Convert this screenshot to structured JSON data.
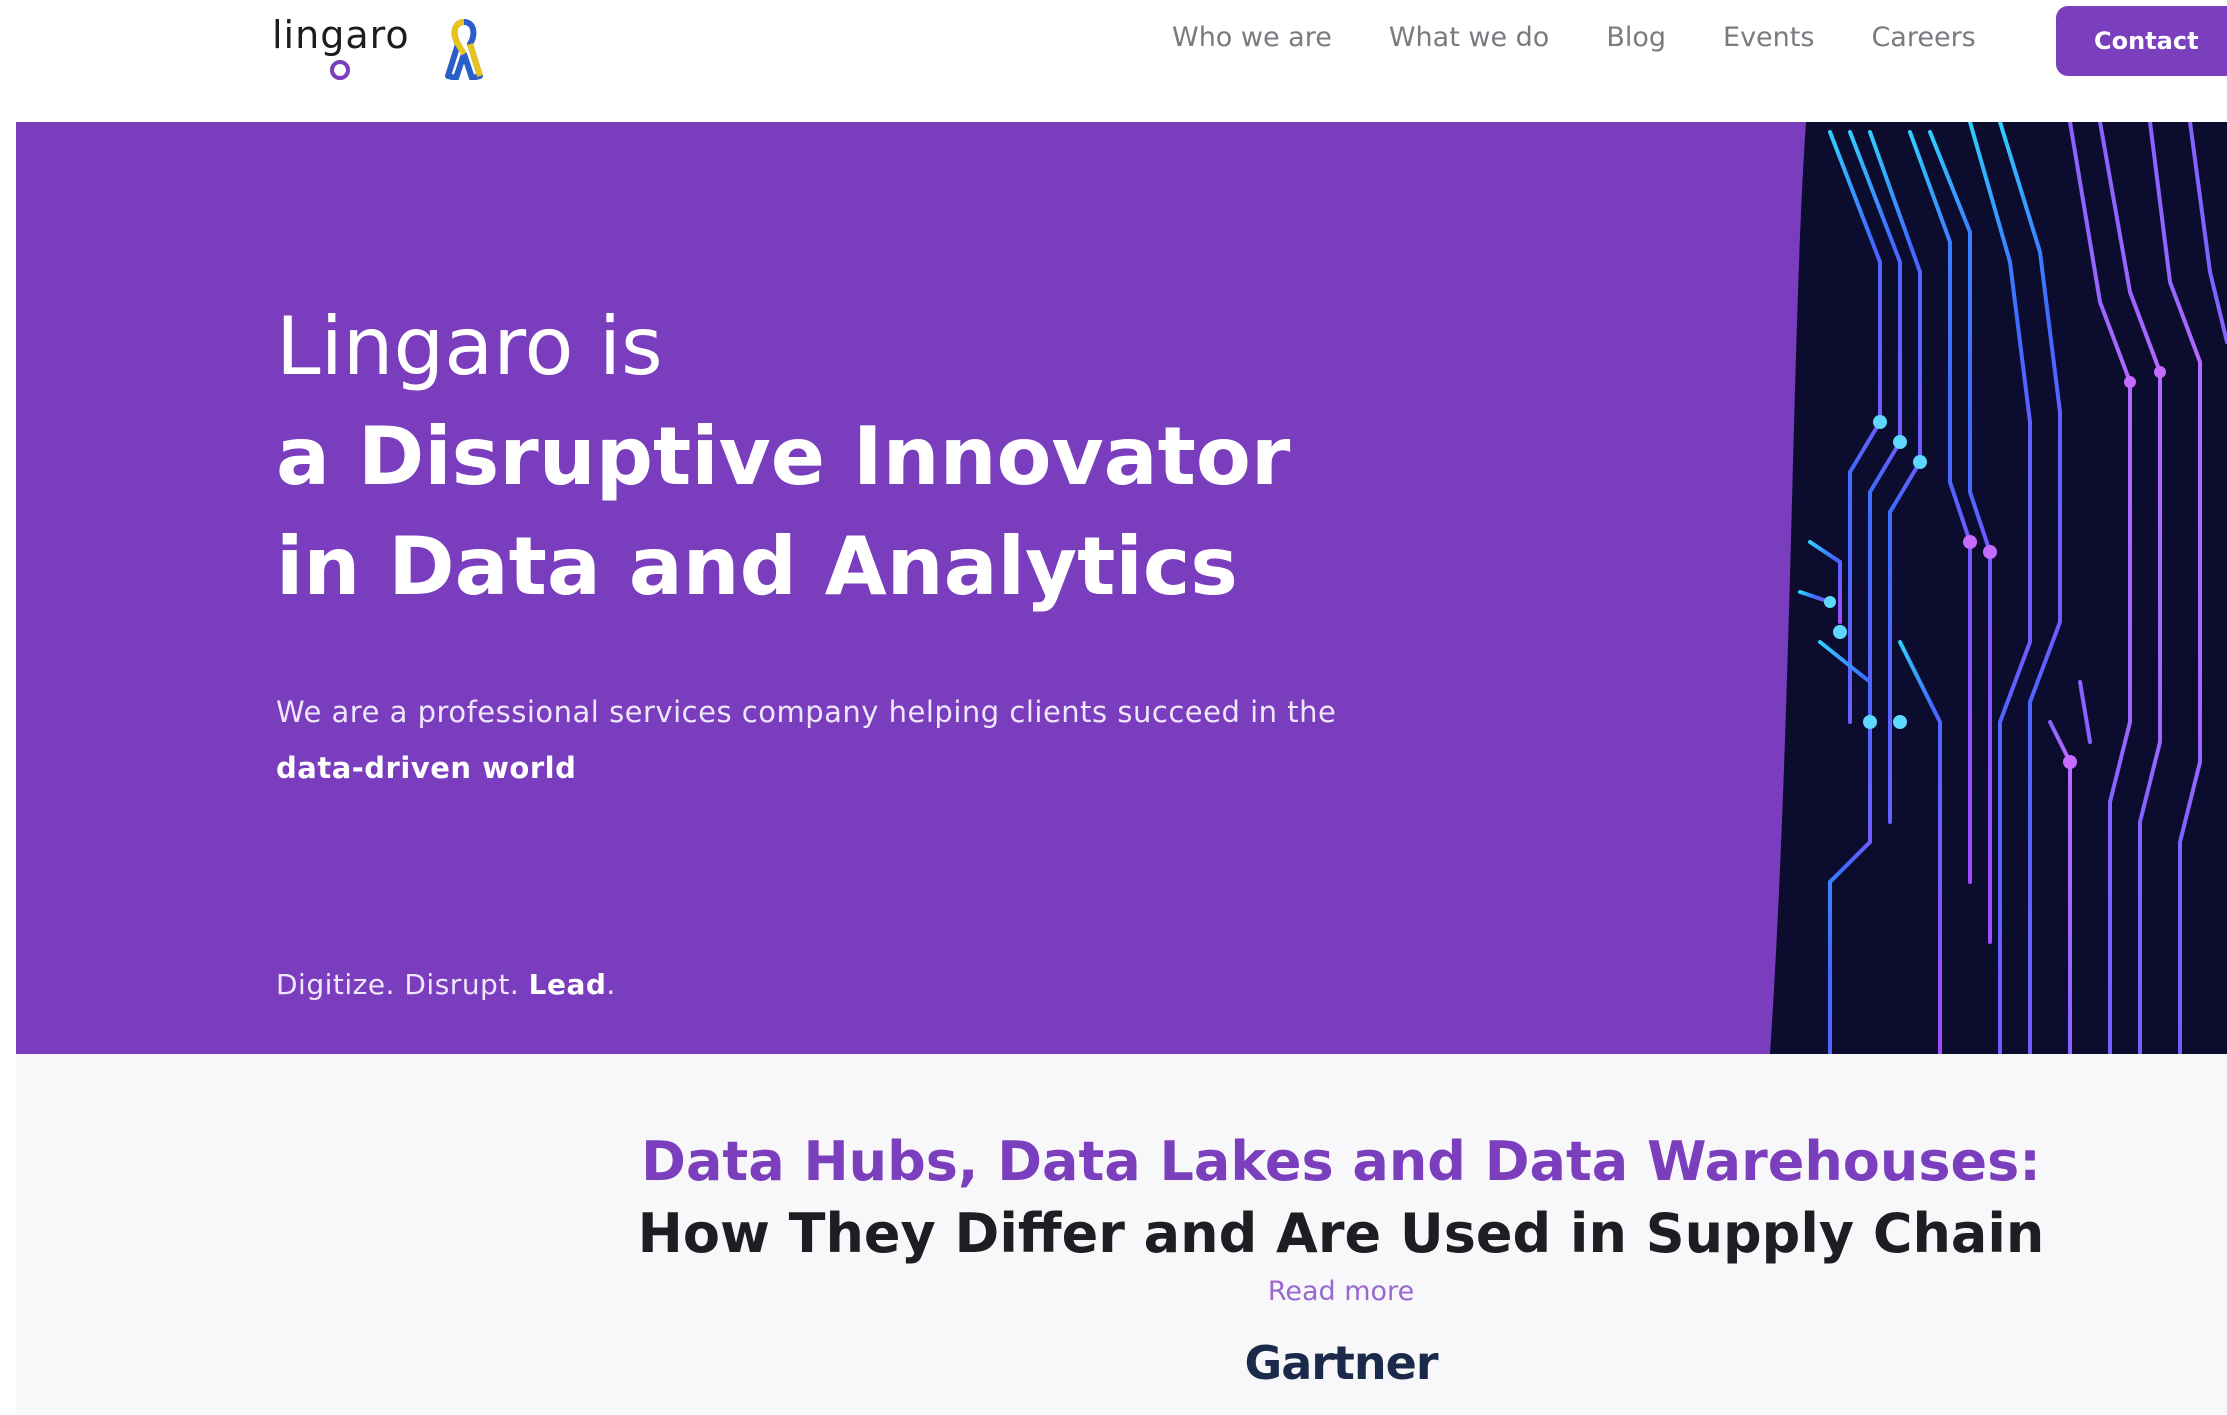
{
  "header": {
    "logo_text": "lingaro",
    "nav": [
      {
        "label": "Who we are"
      },
      {
        "label": "What we do"
      },
      {
        "label": "Blog"
      },
      {
        "label": "Events"
      },
      {
        "label": "Careers"
      }
    ],
    "contact_label": "Contact"
  },
  "hero": {
    "title_line1": "Lingaro is",
    "title_line2": "a Disruptive Innovator",
    "title_line3": "in Data and Analytics",
    "subtitle": "We are a professional services company helping clients succeed in the",
    "subtitle_strong": "data-driven world",
    "tagline_part1": "Digitize. Disrupt. ",
    "tagline_strong": "Lead",
    "tagline_end": "."
  },
  "feature": {
    "title_purple": "Data Hubs, Data Lakes and Data Warehouses:",
    "title_dark": "How They Differ and Are Used in Supply Chain",
    "read_more": "Read more",
    "partner_logo_text": "Gartner"
  },
  "colors": {
    "brand_purple": "#7a3dbe",
    "button_purple": "#7b3fbe",
    "link_purple": "#9a67d0",
    "nav_gray": "#7a7a80",
    "gartner_navy": "#1b2a4a"
  },
  "icons": [
    "ukraine-ribbon-icon"
  ]
}
